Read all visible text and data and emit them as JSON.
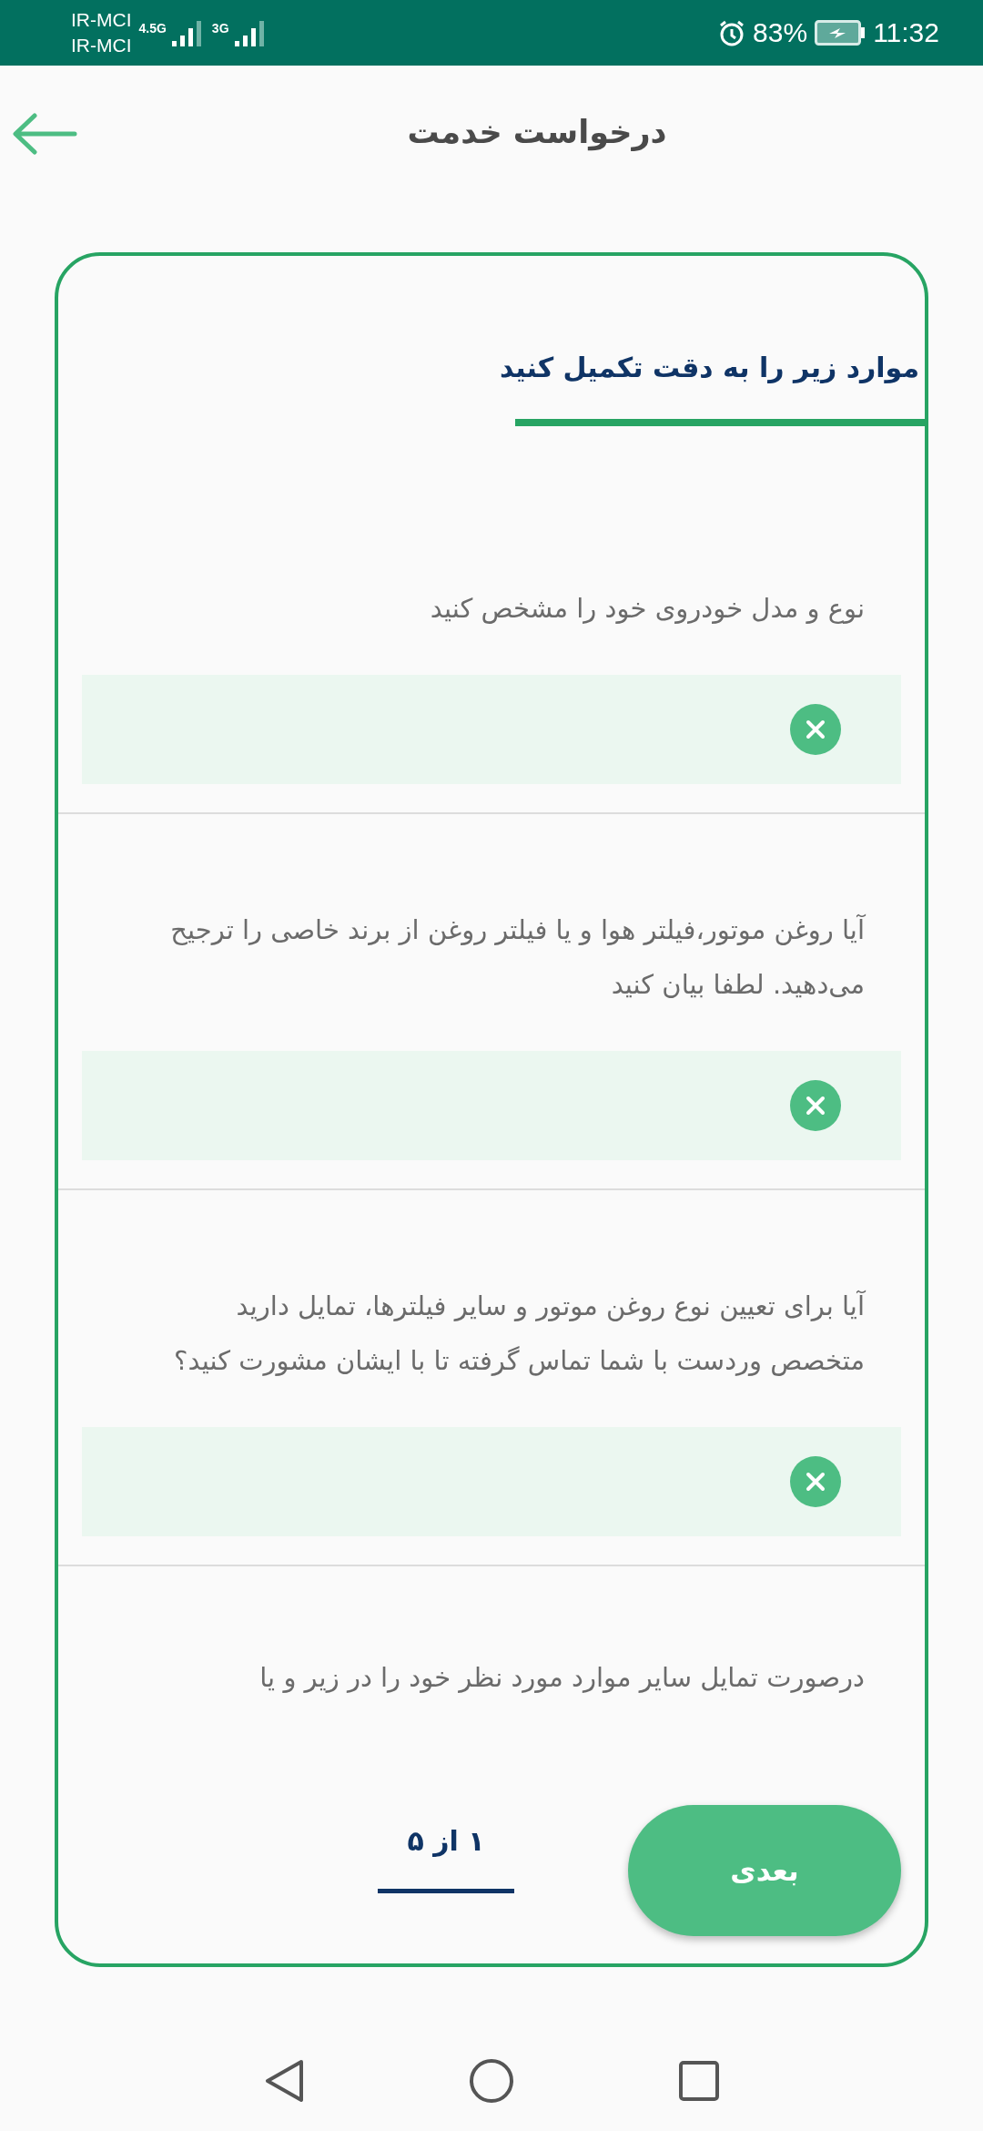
{
  "status_bar": {
    "carriers": [
      "IR-MCI",
      "IR-MCI"
    ],
    "sim1_network": "4.5G",
    "sim2_network": "3G",
    "battery": "83%",
    "time": "11:32"
  },
  "header": {
    "title": "درخواست خدمت"
  },
  "form": {
    "heading": "موارد زیر را به دقت تکمیل کنید",
    "questions": [
      {
        "text": "نوع و مدل خودروی خود را مشخص کنید",
        "kind": "field"
      },
      {
        "text": "آیا روغن موتور،فیلتر هوا و یا فیلتر روغن از برند خاصی را ترجیح می‌دهید. لطفا بیان کنید",
        "kind": "field"
      },
      {
        "text": "آیا برای تعیین نوع روغن موتور و سایر فیلترها، تمایل دارید متخصص وردست با شما تماس گرفته تا با ایشان مشورت کنید؟",
        "kind": "field"
      },
      {
        "text": "درصورت تمایل سایر موارد مورد نظر خود را در زیر و یا",
        "kind": "cut"
      }
    ],
    "page_indicator": "۱ از ۵",
    "next_button": "بعدی"
  }
}
